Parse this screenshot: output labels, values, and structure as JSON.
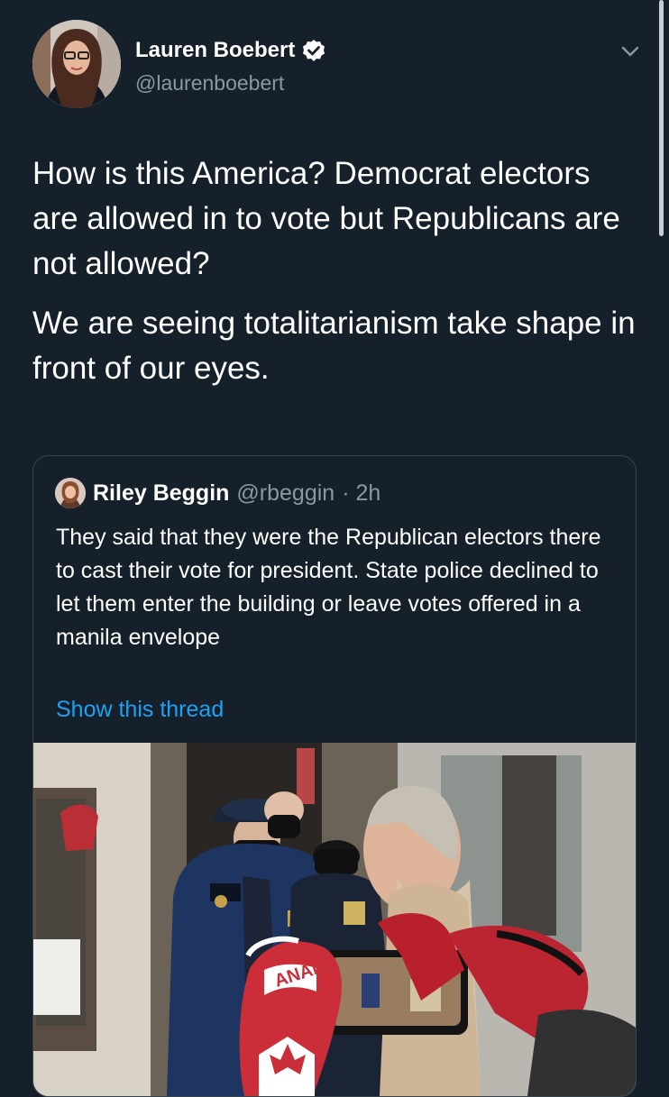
{
  "author": {
    "name": "Lauren Boebert",
    "handle": "@laurenboebert",
    "avatar_icon": "profile-photo-icon",
    "verified_icon": "verified-badge-icon"
  },
  "tweet": {
    "paragraphs": [
      "How is this America? Democrat electors are allowed in to vote but Republicans are not allowed?",
      "We are seeing totalitarianism take shape in front of our eyes."
    ]
  },
  "quoted_tweet": {
    "name": "Riley Beggin",
    "handle": "@rbeggin",
    "time": "· 2h",
    "text": "They said that they were the Republican electors there to cast their vote for president. State police declined to let them enter the building or leave votes offered in a manila envelope",
    "show_thread_label": "Show this thread",
    "media": {
      "hat_text": "ANADA"
    }
  },
  "ui": {
    "menu_icon": "chevron-down-icon",
    "accent_color": "#1da1f2",
    "background_color": "#15202b",
    "border_color": "#38444d",
    "muted_text_color": "#8899a6"
  }
}
